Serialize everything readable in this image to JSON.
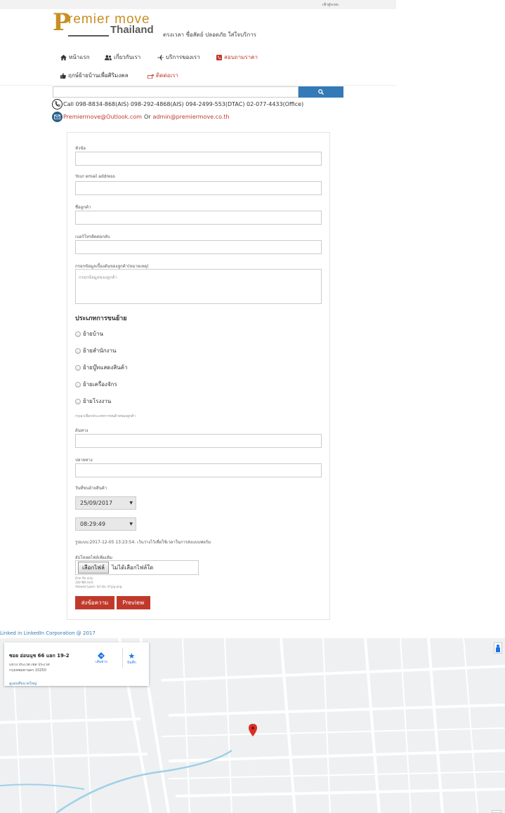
{
  "topbar": {
    "login_label": "เข้าสู่ระบบ"
  },
  "brand": {
    "letter": "P",
    "word1": "remier move",
    "word2": "Thailand",
    "tagline": "ตรงเวลา ซื่อสัตย์ ปลอดภัย ใส่ใจบริการ"
  },
  "nav": {
    "items": [
      {
        "label": "หน้าแรก",
        "icon": "home-icon"
      },
      {
        "label": "เกี่ยวกับเรา",
        "icon": "users-icon"
      },
      {
        "label": "บริการของเรา",
        "icon": "plane-icon"
      },
      {
        "label": "สอบถามราคา",
        "icon": "phone-square-icon",
        "accent": "#c0392b"
      },
      {
        "label": "ฤกษ์ย้ายบ้านเพื่อศิริมงคล",
        "icon": "thumbs-up-icon"
      },
      {
        "label": "ติดต่อเรา",
        "icon": "hand-point-icon",
        "accent": "#c0392b"
      }
    ]
  },
  "search": {
    "placeholder": ""
  },
  "contact": {
    "phone_line": "Call 098-8834-868(AIS) 098-292-4868(AIS) 094-2499-553(DTAC) 02-077-4433(Office)",
    "email1": "Premiermove@Outlook.com",
    "or": "Or",
    "email2": "admin@premiermove.co.th"
  },
  "form": {
    "subject_label": "หัวข้อ",
    "email_label": "Your email address",
    "name_label": "ชื่อลูกค้า",
    "phone_label": "เบอร์โทรติดต่อกลับ",
    "details_label": "กรอกข้อมูลเบื้องต้นของลูกค้า(หมายเหตุ)",
    "details_placeholder": "กรอกข้อมูลของลูกค้า",
    "move_type_title": "ประเภทการขนย้าย",
    "move_types": [
      "ย้ายบ้าน",
      "ย้ายสำนักงาน",
      "ย้ายบู๊ทแสดงสินค้า",
      "ย้ายเครื่องจักร",
      "ย้ายโรงงาน"
    ],
    "move_type_hint": "กรุณาเลือกประเภทการขนย้ายของลูกค้า",
    "origin_label": "ต้นทาง",
    "destination_label": "ปลายทาง",
    "date_label": "วันที่ขนย้ายสินค้า",
    "date_value": "25/09/2017",
    "time_value": "08:29:49",
    "format_note": "รูปแบบ:2017-12-05 13:23:54. เว้นว่างไว้เพื่อใช้เวลาในการส่งแบบฟอร์ม",
    "upload_label": "อัปโหลดไฟล์เพิ่มเติม",
    "file_button": "เลือกไฟล์",
    "file_status": "ไม่ได้เลือกไฟล์ใด",
    "file_info_1": "One file only.",
    "file_info_2": "100 MB limit.",
    "file_info_3": "Allowed types: txt doc tif jpg png.",
    "submit_label": "ส่งข้อความ",
    "preview_label": "Preview"
  },
  "footer": {
    "text": "Linked in LinkedIn Corporation @ 2017"
  },
  "map": {
    "place_title": "ซอย อ่อนนุช 66 แยก 19-2",
    "address_1": "แขวง ประเวศ เขต ประเวศ",
    "address_2": "กรุงเทพมหานคร 10250",
    "directions_label": "เส้นทาง",
    "save_label": "บันทึก",
    "larger_map_label": "ดูแผนที่ขนาดใหญ่",
    "road_color": "#ffffff",
    "water_color": "#9fd0e8",
    "pin_color": "#d93025"
  }
}
